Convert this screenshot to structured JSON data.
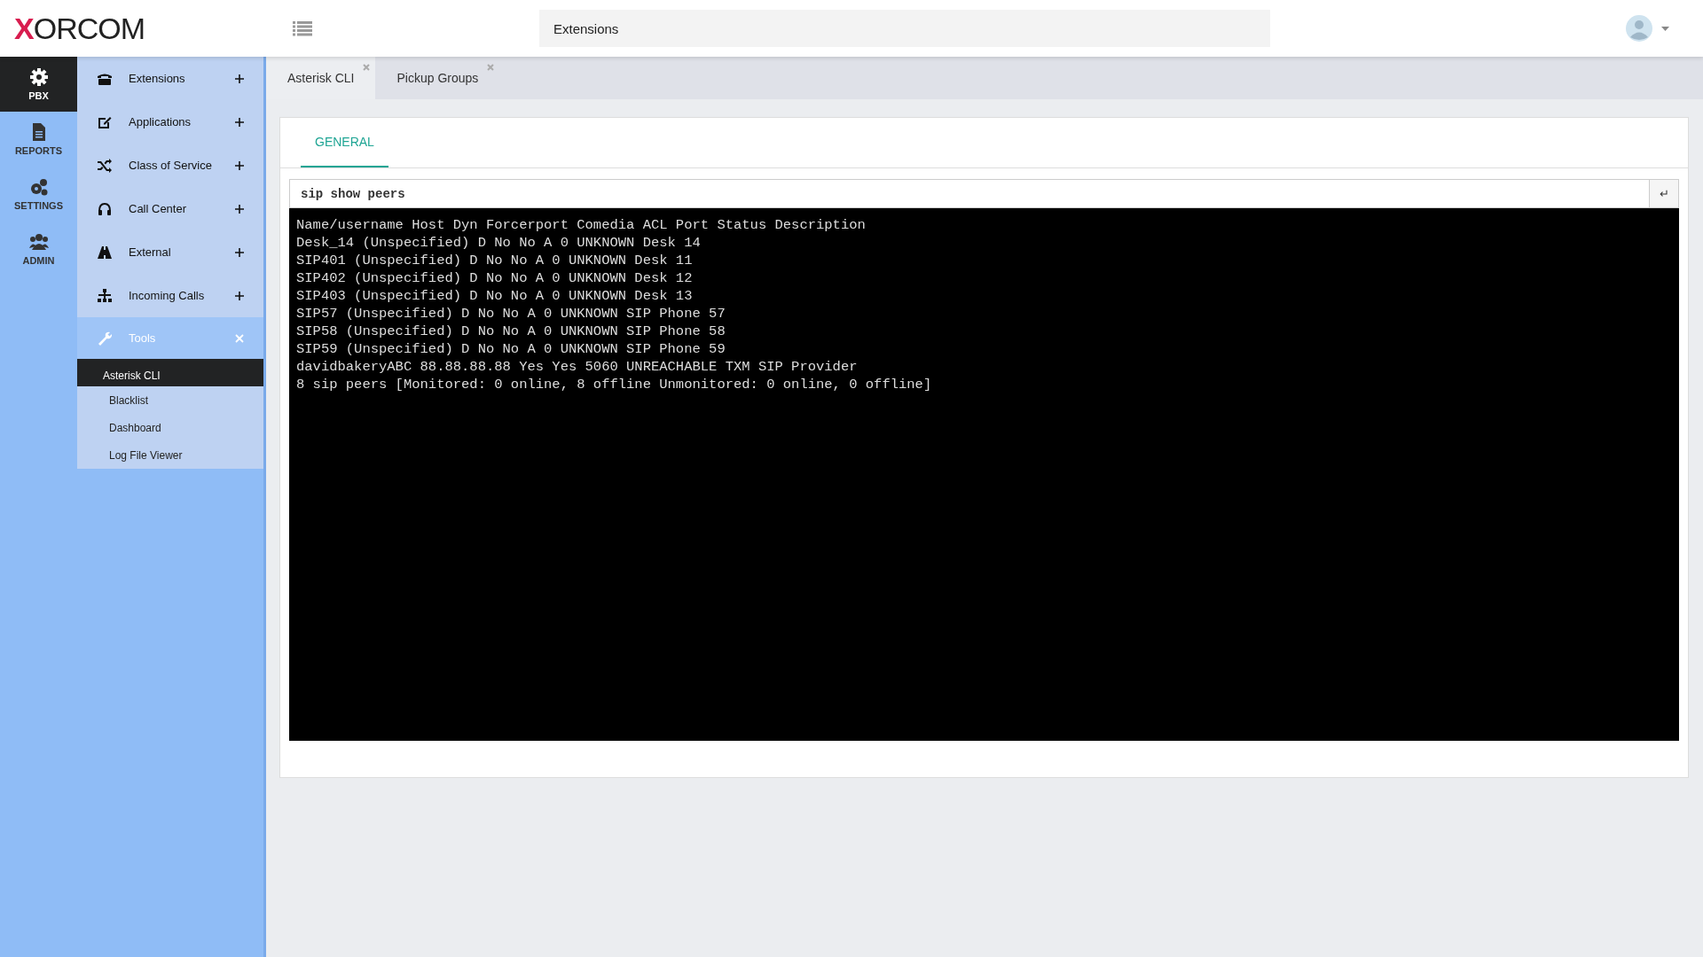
{
  "header": {
    "logo": "XORCOM",
    "breadcrumb": "Extensions"
  },
  "rail": [
    {
      "label": "PBX",
      "selected": true
    },
    {
      "label": "REPORTS",
      "selected": false
    },
    {
      "label": "SETTINGS",
      "selected": false
    },
    {
      "label": "ADMIN",
      "selected": false
    }
  ],
  "menu": [
    {
      "label": "Extensions",
      "expanded": false
    },
    {
      "label": "Applications",
      "expanded": false
    },
    {
      "label": "Class of Service",
      "expanded": false
    },
    {
      "label": "Call Center",
      "expanded": false
    },
    {
      "label": "External",
      "expanded": false
    },
    {
      "label": "Incoming Calls",
      "expanded": false
    },
    {
      "label": "Tools",
      "expanded": true,
      "children": [
        {
          "label": "Asterisk CLI",
          "selected": true
        },
        {
          "label": "Blacklist",
          "selected": false
        },
        {
          "label": "Dashboard",
          "selected": false
        },
        {
          "label": "Log File Viewer",
          "selected": false
        }
      ]
    }
  ],
  "tabs": [
    {
      "label": "Asterisk CLI",
      "selected": true
    },
    {
      "label": "Pickup Groups",
      "selected": false
    }
  ],
  "card_tabs": [
    {
      "label": "GENERAL",
      "selected": true
    }
  ],
  "command": {
    "value": "sip show peers",
    "submit": "↵"
  },
  "console": [
    "Name/username Host Dyn Forcerport Comedia ACL Port Status Description",
    "Desk_14 (Unspecified) D No No A 0 UNKNOWN Desk 14",
    "SIP401 (Unspecified) D No No A 0 UNKNOWN Desk 11",
    "SIP402 (Unspecified) D No No A 0 UNKNOWN Desk 12",
    "SIP403 (Unspecified) D No No A 0 UNKNOWN Desk 13",
    "SIP57 (Unspecified) D No No A 0 UNKNOWN SIP Phone 57",
    "SIP58 (Unspecified) D No No A 0 UNKNOWN SIP Phone 58",
    "SIP59 (Unspecified) D No No A 0 UNKNOWN SIP Phone 59",
    "davidbakeryABC 88.88.88.88 Yes Yes 5060 UNREACHABLE TXM SIP Provider",
    "8 sip peers [Monitored: 0 online, 8 offline Unmonitored: 0 online, 0 offline]"
  ]
}
